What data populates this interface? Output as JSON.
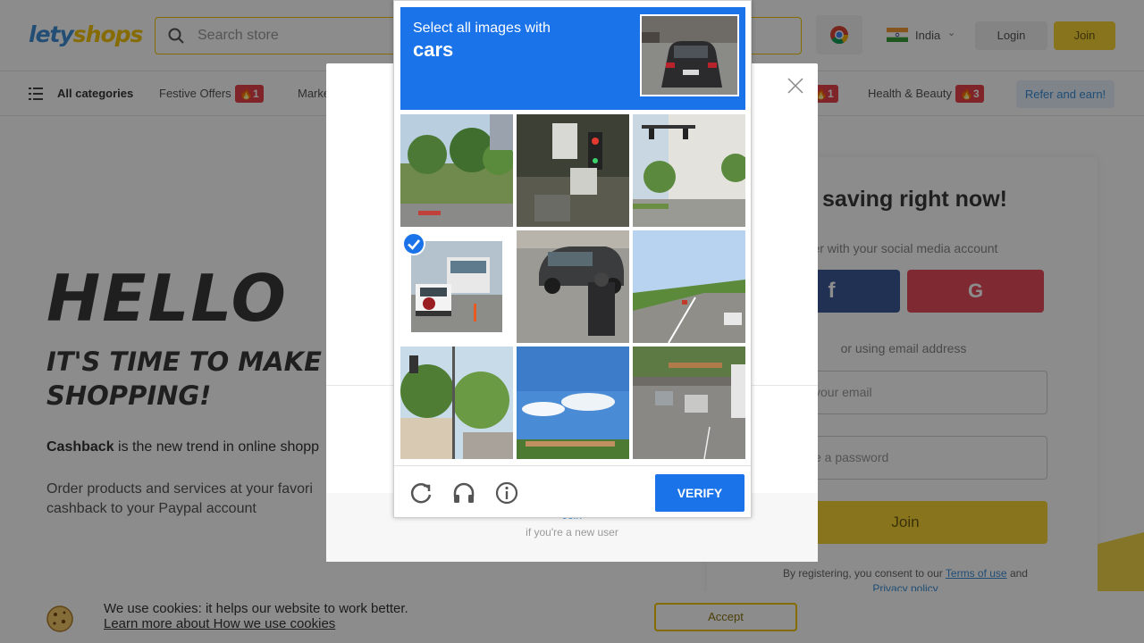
{
  "header": {
    "logo_part1": "lety",
    "logo_part2": "shops",
    "search_placeholder": "Search store",
    "country": "India",
    "login": "Login",
    "join": "Join"
  },
  "nav": {
    "all_categories": "All categories",
    "items": [
      {
        "label": "Festive Offers",
        "badge": "1"
      },
      {
        "label": "Marke"
      },
      {
        "badge": "1"
      },
      {
        "label": "Health & Beauty",
        "badge": "3"
      }
    ],
    "refer": "Refer and earn!"
  },
  "hero": {
    "hello": "HELLO",
    "subtitle_line1": "IT'S TIME TO MAKE M",
    "subtitle_line2": "SHOPPING!",
    "p1_bold": "Cashback",
    "p1_rest": " is the new trend in online shopp",
    "p2_line1": "Order products and services at your favori",
    "p2_line2": "cashback to your Paypal account"
  },
  "register": {
    "title": "rt saving right now!",
    "social_label": "ter with your social media account",
    "fb": "f",
    "google": "G",
    "email_label": "or using email address",
    "email_placeholder": "your email",
    "password_placeholder": "e a password",
    "join": "Join",
    "terms_pre": "By registering, you consent to our ",
    "terms_link": "Terms of use",
    "terms_post": " and",
    "privacy": "Privacy policy"
  },
  "modal": {
    "join_link": "Join",
    "new_user": "if you're a new user"
  },
  "captcha": {
    "instruction": "Select all images with",
    "target": "cars",
    "verify": "VERIFY",
    "selected_tiles": [
      3
    ],
    "colors": {
      "primary": "#1a73e8"
    }
  },
  "cookie": {
    "text": "We use cookies: it helps our website to work better.",
    "link": "Learn more about How we use cookies",
    "accept": "Accept"
  }
}
